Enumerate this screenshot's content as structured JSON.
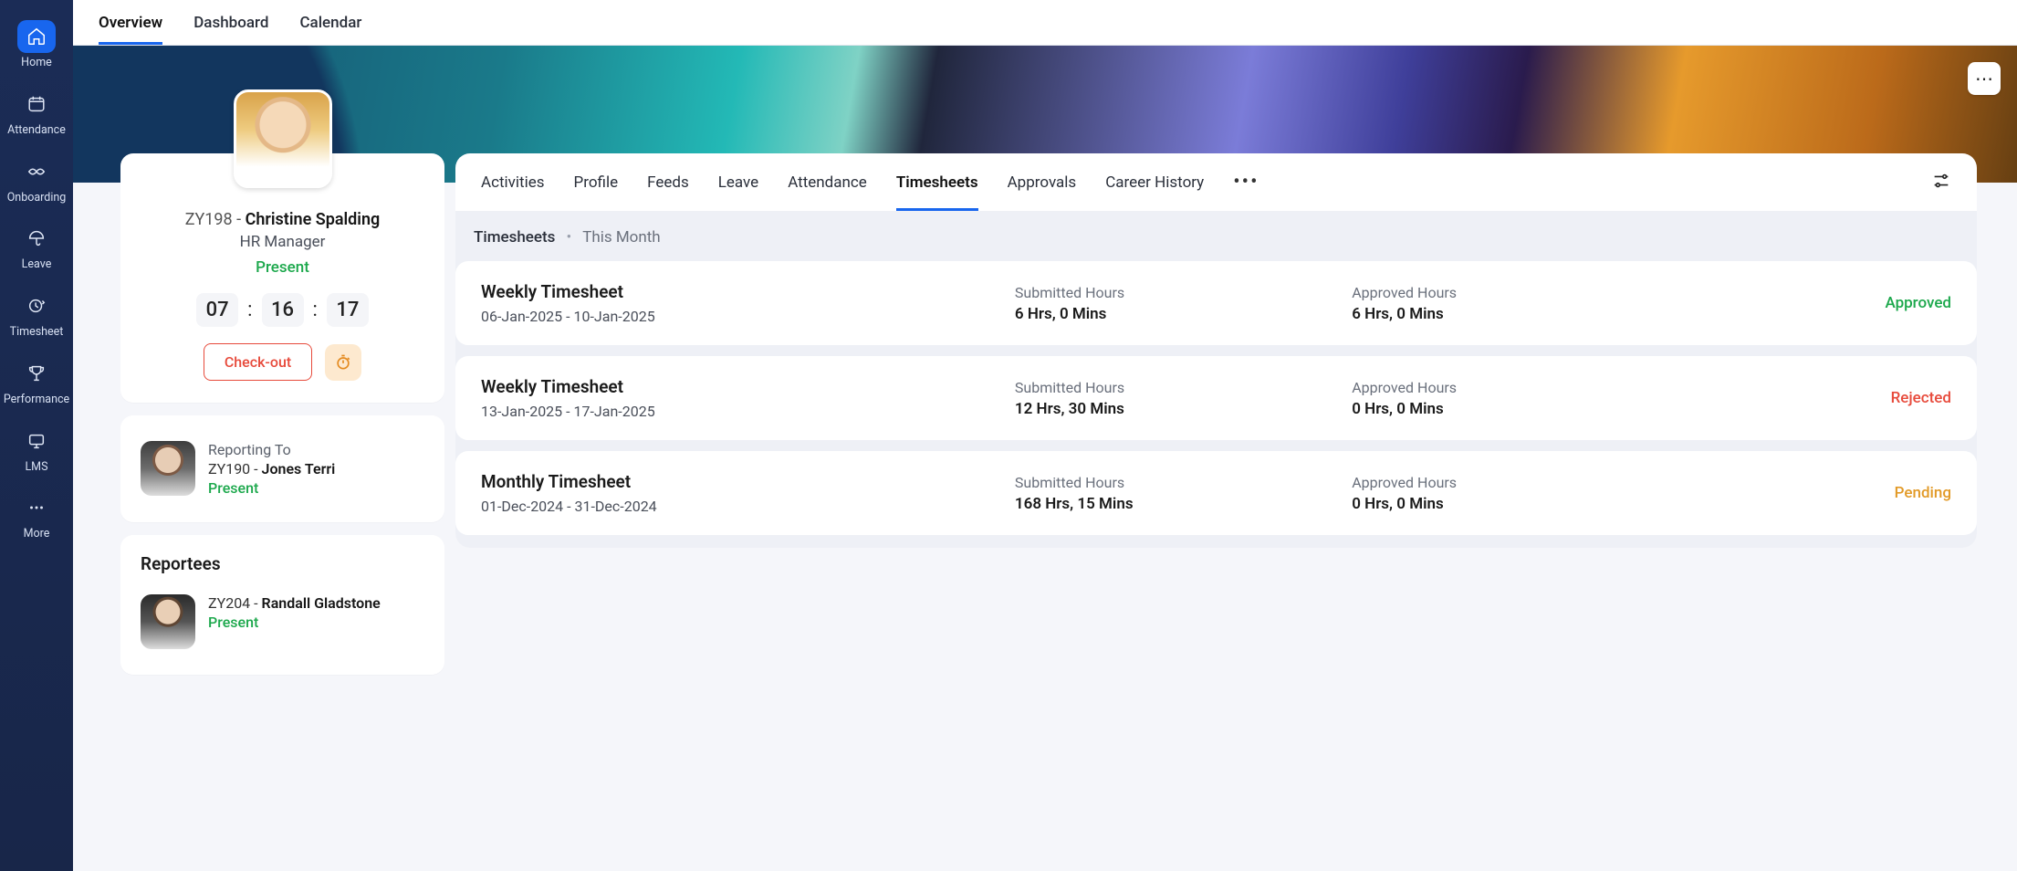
{
  "sidebar": {
    "items": [
      {
        "key": "home",
        "label": "Home"
      },
      {
        "key": "attendance",
        "label": "Attendance"
      },
      {
        "key": "onboarding",
        "label": "Onboarding"
      },
      {
        "key": "leave",
        "label": "Leave"
      },
      {
        "key": "timesheet",
        "label": "Timesheet"
      },
      {
        "key": "performance",
        "label": "Performance"
      },
      {
        "key": "lms",
        "label": "LMS"
      },
      {
        "key": "more",
        "label": "More"
      }
    ]
  },
  "top_tabs": {
    "overview": "Overview",
    "dashboard": "Dashboard",
    "calendar": "Calendar"
  },
  "profile": {
    "emp_id": "ZY198",
    "sep": " - ",
    "name": "Christine Spalding",
    "role": "HR Manager",
    "status": "Present",
    "clock": {
      "h": "07",
      "m": "16",
      "s": "17"
    },
    "checkout_label": "Check-out"
  },
  "reporting": {
    "label": "Reporting To",
    "id": "ZY190",
    "sep": " - ",
    "name": "Jones Terri",
    "status": "Present"
  },
  "reportees": {
    "heading": "Reportees",
    "items": [
      {
        "id": "ZY204",
        "sep": " - ",
        "name": "Randall Gladstone",
        "status": "Present"
      }
    ]
  },
  "sub_tabs": {
    "activities": "Activities",
    "profile": "Profile",
    "feeds": "Feeds",
    "leave": "Leave",
    "attendance": "Attendance",
    "timesheets": "Timesheets",
    "approvals": "Approvals",
    "career": "Career History",
    "more": "•••"
  },
  "breadcrumb": {
    "root": "Timesheets",
    "leaf": "This Month"
  },
  "timesheets": [
    {
      "title": "Weekly Timesheet",
      "dates": "06-Jan-2025 - 10-Jan-2025",
      "submitted_label": "Submitted Hours",
      "submitted": "6 Hrs, 0 Mins",
      "approved_label": "Approved Hours",
      "approved": "6 Hrs, 0 Mins",
      "status": "Approved",
      "status_class": "st-approved"
    },
    {
      "title": "Weekly Timesheet",
      "dates": "13-Jan-2025 - 17-Jan-2025",
      "submitted_label": "Submitted Hours",
      "submitted": "12 Hrs, 30 Mins",
      "approved_label": "Approved Hours",
      "approved": "0 Hrs, 0 Mins",
      "status": "Rejected",
      "status_class": "st-rejected"
    },
    {
      "title": "Monthly Timesheet",
      "dates": "01-Dec-2024 - 31-Dec-2024",
      "submitted_label": "Submitted Hours",
      "submitted": "168 Hrs, 15 Mins",
      "approved_label": "Approved Hours",
      "approved": "0 Hrs, 0 Mins",
      "status": "Pending",
      "status_class": "st-pending"
    }
  ]
}
